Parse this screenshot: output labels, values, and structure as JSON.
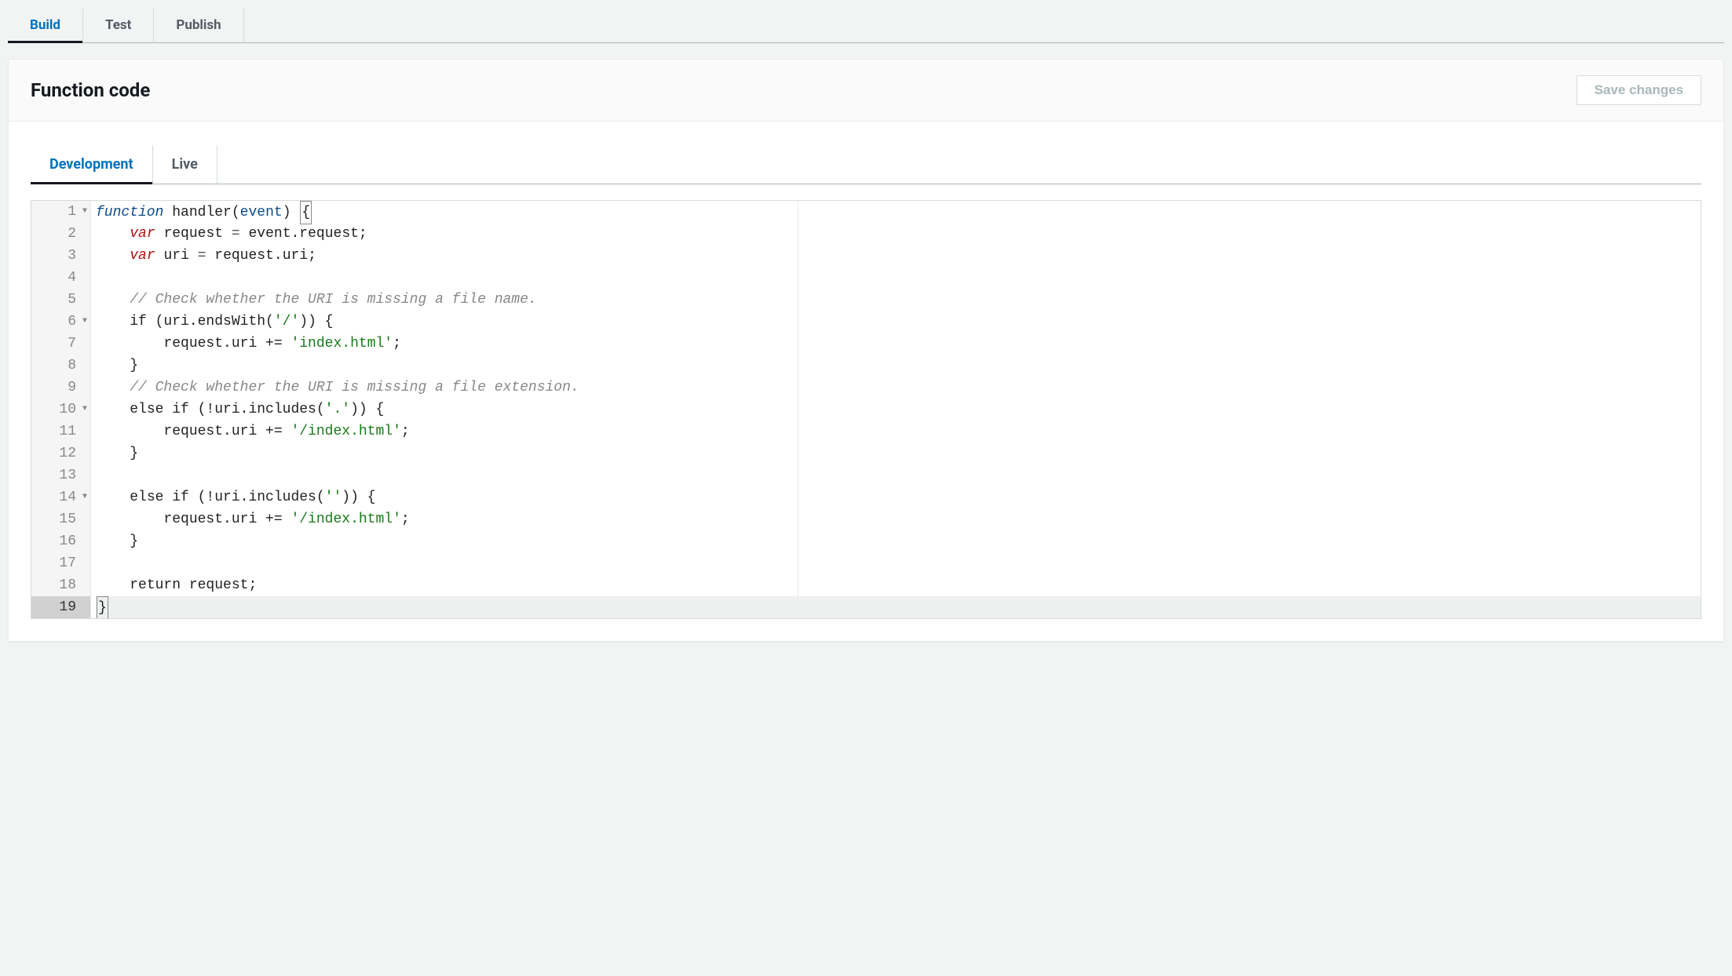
{
  "top_tabs": {
    "build": "Build",
    "test": "Test",
    "publish": "Publish",
    "active": "build"
  },
  "panel": {
    "title": "Function code",
    "save_button": "Save changes"
  },
  "sub_tabs": {
    "development": "Development",
    "live": "Live",
    "active": "development"
  },
  "editor": {
    "line_count": 19,
    "current_line": 19,
    "fold_lines": [
      1,
      6,
      10,
      14
    ],
    "code": {
      "l1": {
        "function": "function",
        "handler": "handler",
        "event": "event"
      },
      "l2": {
        "var": "var",
        "request": "request",
        "eq": "=",
        "expr": "event.request;"
      },
      "l3": {
        "var": "var",
        "uri": "uri",
        "eq": "=",
        "expr": "request.uri;"
      },
      "l5": {
        "comment": "// Check whether the URI is missing a file name."
      },
      "l6": {
        "text_a": "if (uri.endsWith(",
        "str": "'/'",
        "text_b": ")) {"
      },
      "l7": {
        "text_a": "request.uri += ",
        "str": "'index.html'",
        "text_b": ";"
      },
      "l8": {
        "text": "}"
      },
      "l9": {
        "comment": "// Check whether the URI is missing a file extension."
      },
      "l10": {
        "text_a": "else if (!uri.includes(",
        "str": "'.'",
        "text_b": ")) {"
      },
      "l11": {
        "text_a": "request.uri += ",
        "str": "'/index.html'",
        "text_b": ";"
      },
      "l12": {
        "text": "}"
      },
      "l14": {
        "text_a": "else if (!uri.includes(",
        "str": "''",
        "text_b": ")) {"
      },
      "l15": {
        "text_a": "request.uri += ",
        "str": "'/index.html'",
        "text_b": ";"
      },
      "l16": {
        "text": "}"
      },
      "l18": {
        "text": "return request;"
      },
      "l19": {
        "text": "}"
      }
    }
  }
}
